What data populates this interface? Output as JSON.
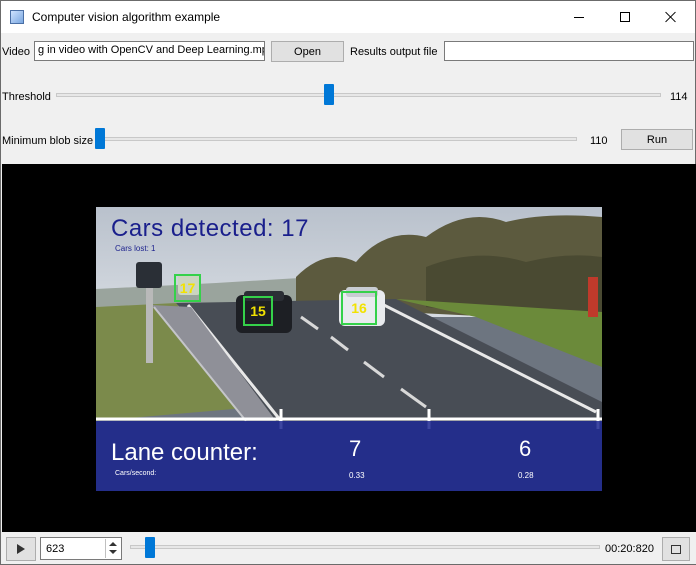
{
  "window": {
    "title": "Computer vision algorithm example"
  },
  "controls": {
    "video_label": "Video",
    "video_value": "g in video with OpenCV and Deep Learning.mp4",
    "open_label": "Open",
    "results_label": "Results output file",
    "results_value": "",
    "threshold_label": "Threshold",
    "threshold_value": "114",
    "threshold_fraction": 0.45,
    "blob_label": "Minimum blob size",
    "blob_value": "110",
    "blob_fraction": 0.0,
    "run_label": "Run"
  },
  "overlay": {
    "cars_detected": "Cars detected: 17",
    "cars_lost": "Cars lost: 1",
    "lane_counter": "Lane counter:",
    "cars_per_second": "Cars/second:",
    "lane1_count": "7",
    "lane1_rate": "0.33",
    "lane2_count": "6",
    "lane2_rate": "0.28",
    "box_ids": [
      "17",
      "15",
      "16"
    ]
  },
  "player": {
    "frame_value": "623",
    "time": "00:20:820",
    "position_fraction": 0.02
  },
  "colors": {
    "accent": "#0078d7",
    "box": "#35d14a",
    "box_id": "#f2e200",
    "overlay_text": "#1a1f8c"
  }
}
